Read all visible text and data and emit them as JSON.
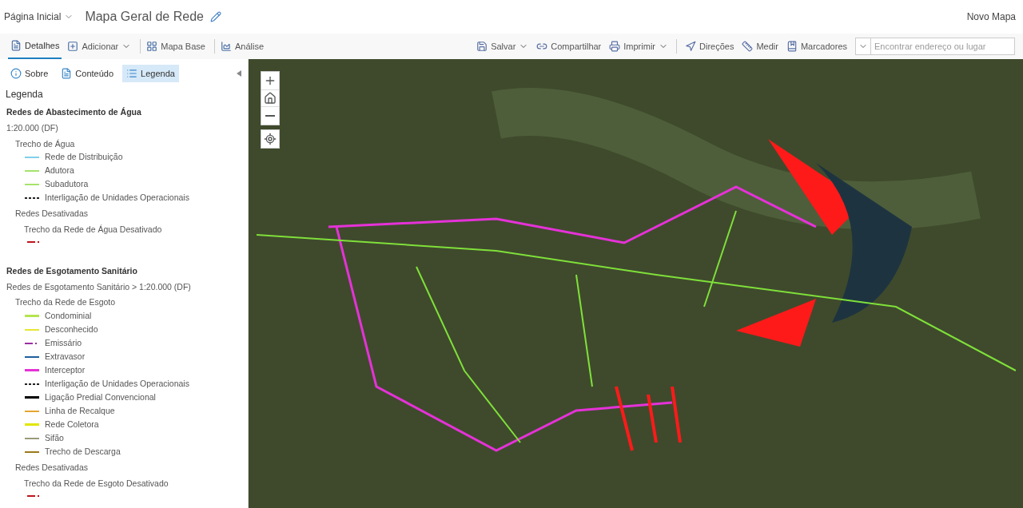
{
  "header": {
    "home": "Página Inicial",
    "title": "Mapa Geral de Rede",
    "new_map": "Novo Mapa"
  },
  "toolbar": {
    "left": [
      {
        "label": "Detalhes",
        "selected": true,
        "kind": "tab"
      },
      {
        "label": "Adicionar",
        "selected": false,
        "kind": "menu"
      },
      {
        "label": "Mapa Base",
        "selected": false,
        "kind": "tab"
      },
      {
        "label": "Análise",
        "selected": false,
        "kind": "tab"
      }
    ],
    "right": [
      {
        "label": "Salvar",
        "kind": "menu"
      },
      {
        "label": "Compartilhar",
        "kind": "button"
      },
      {
        "label": "Imprimir",
        "kind": "menu"
      },
      {
        "label": "Direções",
        "kind": "button"
      },
      {
        "label": "Medir",
        "kind": "button"
      },
      {
        "label": "Marcadores",
        "kind": "button"
      }
    ],
    "search": {
      "placeholder": "Encontrar endereço ou lugar"
    }
  },
  "panel_tabs": [
    {
      "label": "Sobre",
      "selected": false
    },
    {
      "label": "Conteúdo",
      "selected": false
    },
    {
      "label": "Legenda",
      "selected": true
    }
  ],
  "legend": {
    "title": "Legenda",
    "sections": [
      {
        "title": "Redes de Abastecimento de Água",
        "subtitle": "1:20.000 (DF)",
        "groups": [
          {
            "label": "Trecho de Água",
            "items": [
              {
                "label": "Rede de Distribuição",
                "color": "#7fd0e8",
                "kind": "solid"
              },
              {
                "label": "Adutora",
                "color": "#a6e36b",
                "kind": "solid"
              },
              {
                "label": "Subadutora",
                "color": "#a6e36b",
                "kind": "solid"
              },
              {
                "label": "Interligação de Unidades Operacionais",
                "color": "#222222",
                "kind": "dashed"
              }
            ]
          },
          {
            "label": "Redes Desativadas",
            "children": [
              {
                "label": "Trecho da Rede de Água Desativado",
                "color": "#c0141b",
                "kind": "dashdot"
              }
            ]
          }
        ]
      },
      {
        "title": "Redes de Esgotamento Sanitário",
        "subtitle": "Redes de Esgotamento Sanitário > 1:20.000 (DF)",
        "groups": [
          {
            "label": "Trecho da Rede de Esgoto",
            "items": [
              {
                "label": "Condominial",
                "color": "#b6e34f",
                "kind": "thick"
              },
              {
                "label": "Desconhecido",
                "color": "#e6e633",
                "kind": "solid"
              },
              {
                "label": "Emissário",
                "color": "#9b2ea0",
                "kind": "dashdot"
              },
              {
                "label": "Extravasor",
                "color": "#1f5f9e",
                "kind": "solid"
              },
              {
                "label": "Interceptor",
                "color": "#e532d8",
                "kind": "thick"
              },
              {
                "label": "Interligação de Unidades Operacionais",
                "color": "#222222",
                "kind": "dashed"
              },
              {
                "label": "Ligação Predial Convencional",
                "color": "#000000",
                "kind": "thick"
              },
              {
                "label": "Linha de Recalque",
                "color": "#e6a62e",
                "kind": "solid"
              },
              {
                "label": "Rede Coletora",
                "color": "#e2e600",
                "kind": "thick"
              },
              {
                "label": "Sifão",
                "color": "#9a9a7a",
                "kind": "solid"
              },
              {
                "label": "Trecho de Descarga",
                "color": "#9a7a1a",
                "kind": "solid"
              }
            ]
          },
          {
            "label": "Redes Desativadas",
            "children": [
              {
                "label": "Trecho da Rede de Esgoto Desativado",
                "color": "#c0141b",
                "kind": "dashdot"
              }
            ]
          }
        ]
      }
    ]
  }
}
